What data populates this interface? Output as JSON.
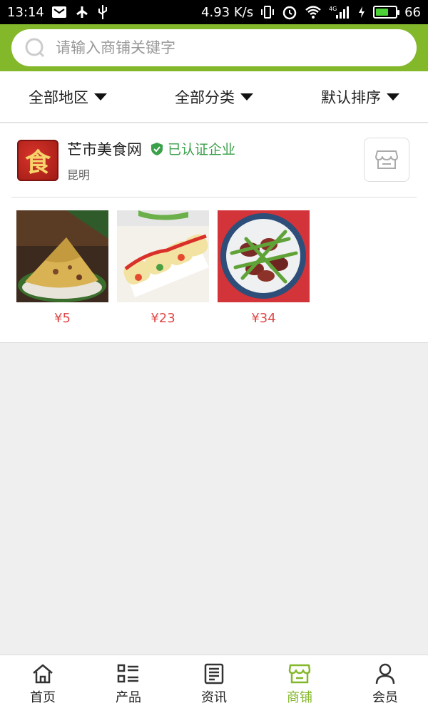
{
  "status_bar": {
    "time": "13:14",
    "speed": "4.93 K/s",
    "network": "4G",
    "battery_percent": "66",
    "battery_level": 0.66
  },
  "search": {
    "placeholder": "请输入商铺关键字"
  },
  "filters": {
    "region": "全部地区",
    "category": "全部分类",
    "sort": "默认排序"
  },
  "shop": {
    "logo_char": "食",
    "name": "芒市美食网",
    "verified_label": "已认证企业",
    "city": "昆明",
    "products": [
      {
        "price": "¥5"
      },
      {
        "price": "¥23"
      },
      {
        "price": "¥34"
      }
    ]
  },
  "bottom_nav": {
    "items": [
      {
        "label": "首页",
        "icon": "home-icon"
      },
      {
        "label": "产品",
        "icon": "list-icon"
      },
      {
        "label": "资讯",
        "icon": "news-icon"
      },
      {
        "label": "商铺",
        "icon": "store-icon"
      },
      {
        "label": "会员",
        "icon": "user-icon"
      }
    ],
    "active_index": 3
  },
  "colors": {
    "brand_green": "#84b82b",
    "verified_green": "#3aa04a",
    "price_red": "#e04848"
  }
}
